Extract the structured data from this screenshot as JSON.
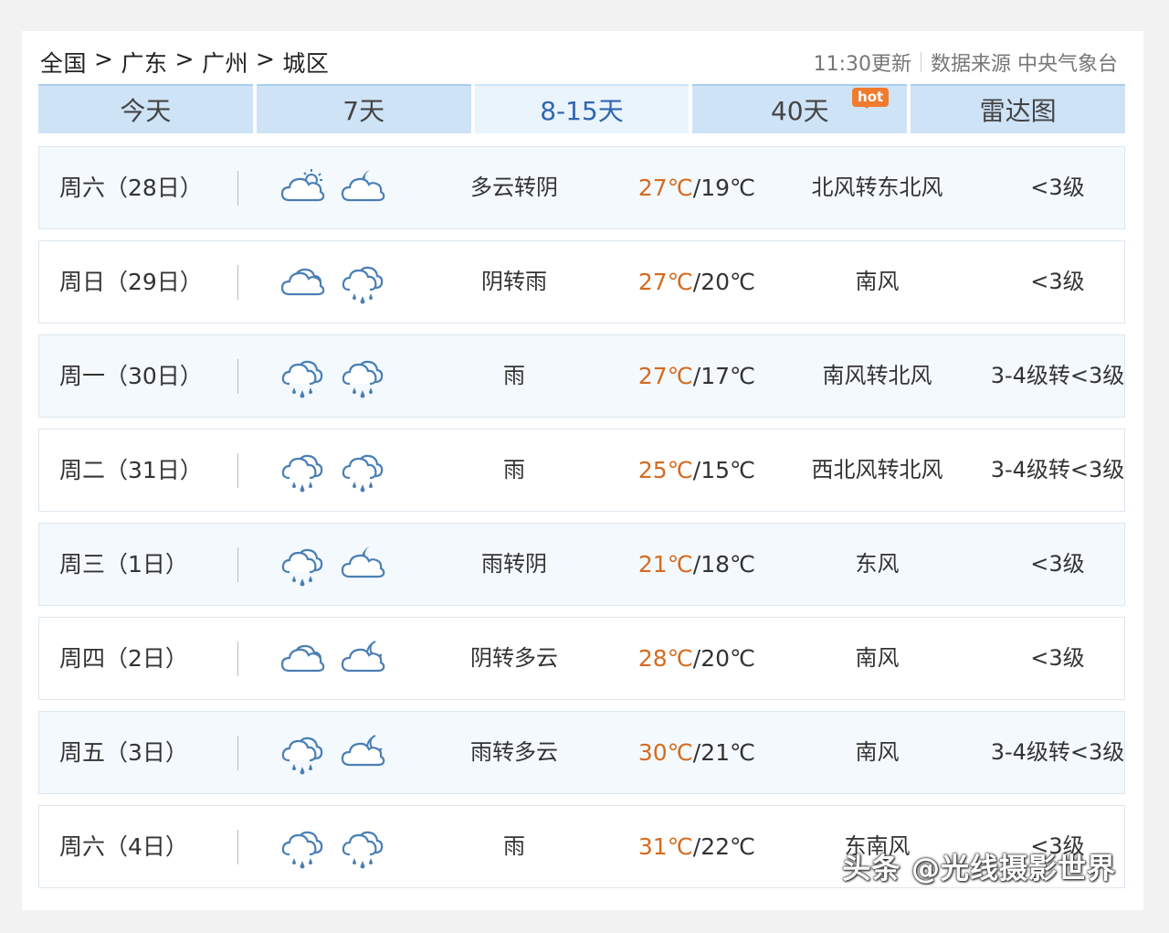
{
  "breadcrumb": {
    "items": [
      "全国",
      "广东",
      "广州",
      "城区"
    ],
    "separator": ">"
  },
  "meta": {
    "update": "11:30更新",
    "source": "数据来源 中央气象台"
  },
  "tabs": [
    {
      "label": "今天",
      "active": false
    },
    {
      "label": "7天",
      "active": false
    },
    {
      "label": "8-15天",
      "active": true
    },
    {
      "label": "40天",
      "active": false,
      "badge": "hot"
    },
    {
      "label": "雷达图",
      "active": false
    }
  ],
  "colors": {
    "high_temp": "#d46b1f",
    "icon_stroke": "#4a7fb5",
    "tab_bg": "#cfe3f7",
    "tab_active_text": "#2f66b1"
  },
  "forecast": [
    {
      "day": "周六（28日）",
      "icon_day": "partly-cloudy-day-icon",
      "icon_night": "partly-cloudy-night-icon",
      "desc": "多云转阴",
      "high": "27℃",
      "low": "19℃",
      "wind": "北风转东北风",
      "level": "<3级"
    },
    {
      "day": "周日（29日）",
      "icon_day": "overcast-icon",
      "icon_night": "rain-icon",
      "desc": "阴转雨",
      "high": "27℃",
      "low": "20℃",
      "wind": "南风",
      "level": "<3级"
    },
    {
      "day": "周一（30日）",
      "icon_day": "rain-icon",
      "icon_night": "rain-icon",
      "desc": "雨",
      "high": "27℃",
      "low": "17℃",
      "wind": "南风转北风",
      "level": "3-4级转<3级"
    },
    {
      "day": "周二（31日）",
      "icon_day": "rain-icon",
      "icon_night": "rain-icon",
      "desc": "雨",
      "high": "25℃",
      "low": "15℃",
      "wind": "西北风转北风",
      "level": "3-4级转<3级"
    },
    {
      "day": "周三（1日）",
      "icon_day": "rain-icon",
      "icon_night": "partly-cloudy-night-icon",
      "desc": "雨转阴",
      "high": "21℃",
      "low": "18℃",
      "wind": "东风",
      "level": "<3级"
    },
    {
      "day": "周四（2日）",
      "icon_day": "overcast-icon",
      "icon_night": "cloudy-night-icon",
      "desc": "阴转多云",
      "high": "28℃",
      "low": "20℃",
      "wind": "南风",
      "level": "<3级"
    },
    {
      "day": "周五（3日）",
      "icon_day": "rain-icon",
      "icon_night": "cloudy-night-icon",
      "desc": "雨转多云",
      "high": "30℃",
      "low": "21℃",
      "wind": "南风",
      "level": "3-4级转<3级"
    },
    {
      "day": "周六（4日）",
      "icon_day": "rain-icon",
      "icon_night": "rain-icon",
      "desc": "雨",
      "high": "31℃",
      "low": "22℃",
      "wind": "东南风",
      "level": "<3级"
    }
  ],
  "watermark": "头条 @光线摄影世界"
}
